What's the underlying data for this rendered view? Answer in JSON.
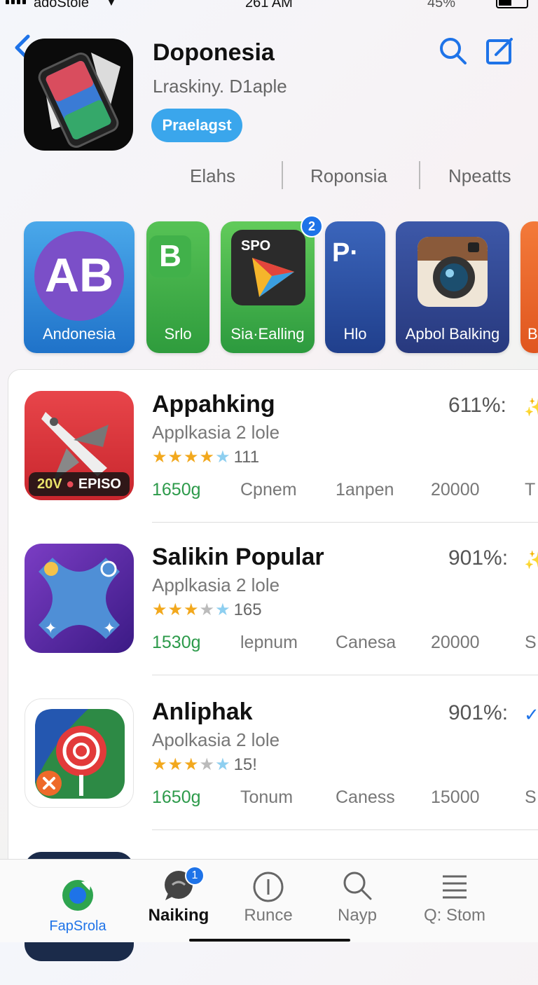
{
  "status_bar": {
    "carrier": "adoStole",
    "time": "261 AM",
    "battery": "45%"
  },
  "header": {
    "app_name": "Doponesia",
    "subtitle": "Lraskiny. D1aple",
    "get_button": "Praelagst",
    "meta": [
      "Elahs",
      "Roponsia",
      "Npeatts"
    ],
    "icons": [
      "back-chevron-icon",
      "search-icon",
      "compose-icon"
    ],
    "accent_color": "#3aa6ec"
  },
  "carousel": {
    "items": [
      {
        "label": "Andonesia",
        "icon_text": "AB"
      },
      {
        "label": "Srlo",
        "icon_text": "B"
      },
      {
        "label": "Sia·Ealling",
        "icon_text": "SPO",
        "badge": "2"
      },
      {
        "label": "Hlo",
        "icon_text": "P·"
      },
      {
        "label": "Apbol Balking",
        "icon_text": ""
      },
      {
        "label": "B",
        "icon_text": ""
      }
    ]
  },
  "list": {
    "items": [
      {
        "title": "Appahking",
        "subtitle": "Applkasia 2 lole",
        "rating": 4.5,
        "rating_count": "111",
        "percent": "611%:",
        "stats": [
          "1650g",
          "Cpnem",
          "1anpen",
          "20000",
          "T"
        ],
        "icon_text": "20V",
        "icon_text2": "EPISO",
        "mark": "sparkle-icon"
      },
      {
        "title": "Salikin Popular",
        "subtitle": "Applkasia 2 lole",
        "rating": 3,
        "rating_count": "165",
        "percent": "901%:",
        "stats": [
          "1530g",
          "lepnum",
          "Canesa",
          "20000",
          "S"
        ],
        "mark": "sparkle-icon"
      },
      {
        "title": "Anliphak",
        "subtitle": "Apolkasia 2 lole",
        "rating": 3,
        "rating_count": "15!",
        "percent": "901%:",
        "stats": [
          "1650g",
          "Tonum",
          "Caness",
          "15000",
          "S"
        ],
        "mark": "checkmark-icon"
      }
    ]
  },
  "tabbar": {
    "items": [
      {
        "label": "FapSrola",
        "icon": "brand-icon"
      },
      {
        "label": "Naiking",
        "icon": "chat-icon",
        "badge": "1",
        "active": true
      },
      {
        "label": "Runce",
        "icon": "info-circle-icon"
      },
      {
        "label": "Nayp",
        "icon": "search-icon"
      },
      {
        "label": "Q: Stom",
        "icon": "list-icon"
      }
    ]
  }
}
